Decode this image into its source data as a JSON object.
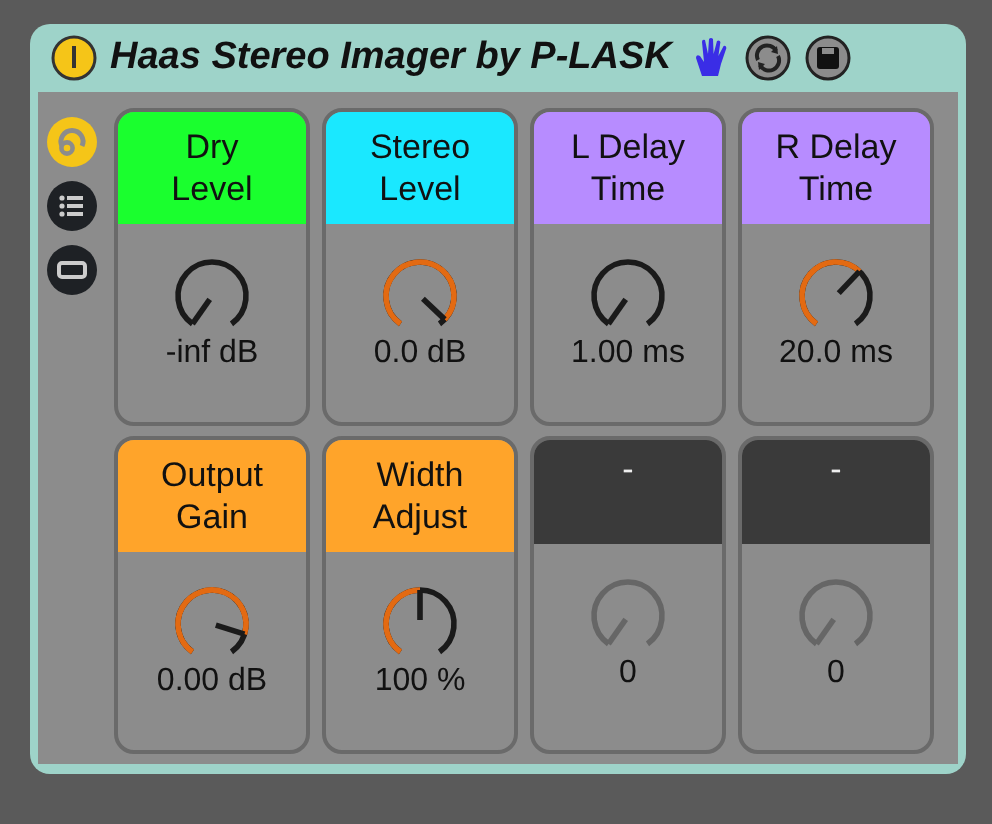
{
  "device": {
    "title": "Haas Stereo Imager by P-LASK",
    "on": true
  },
  "controls": [
    {
      "label": "Dry Level",
      "value": "-inf dB",
      "color": "#1aff2e",
      "disabled": false
    },
    {
      "label": "Stereo Level",
      "value": "0.0 dB",
      "color": "#1ae8ff",
      "disabled": false
    },
    {
      "label": "L Delay Time",
      "value": "1.00 ms",
      "color": "#b78cff",
      "disabled": false
    },
    {
      "label": "R Delay Time",
      "value": "20.0 ms",
      "color": "#b78cff",
      "disabled": false
    },
    {
      "label": "Output Gain",
      "value": "0.00 dB",
      "color": "#ffa42a",
      "disabled": false
    },
    {
      "label": "Width Adjust",
      "value": "100 %",
      "color": "#ffa42a",
      "disabled": false
    },
    {
      "label": "-",
      "value": "0",
      "color": "#3a3a3a",
      "disabled": true
    },
    {
      "label": "-",
      "value": "0",
      "color": "#3a3a3a",
      "disabled": true
    }
  ]
}
